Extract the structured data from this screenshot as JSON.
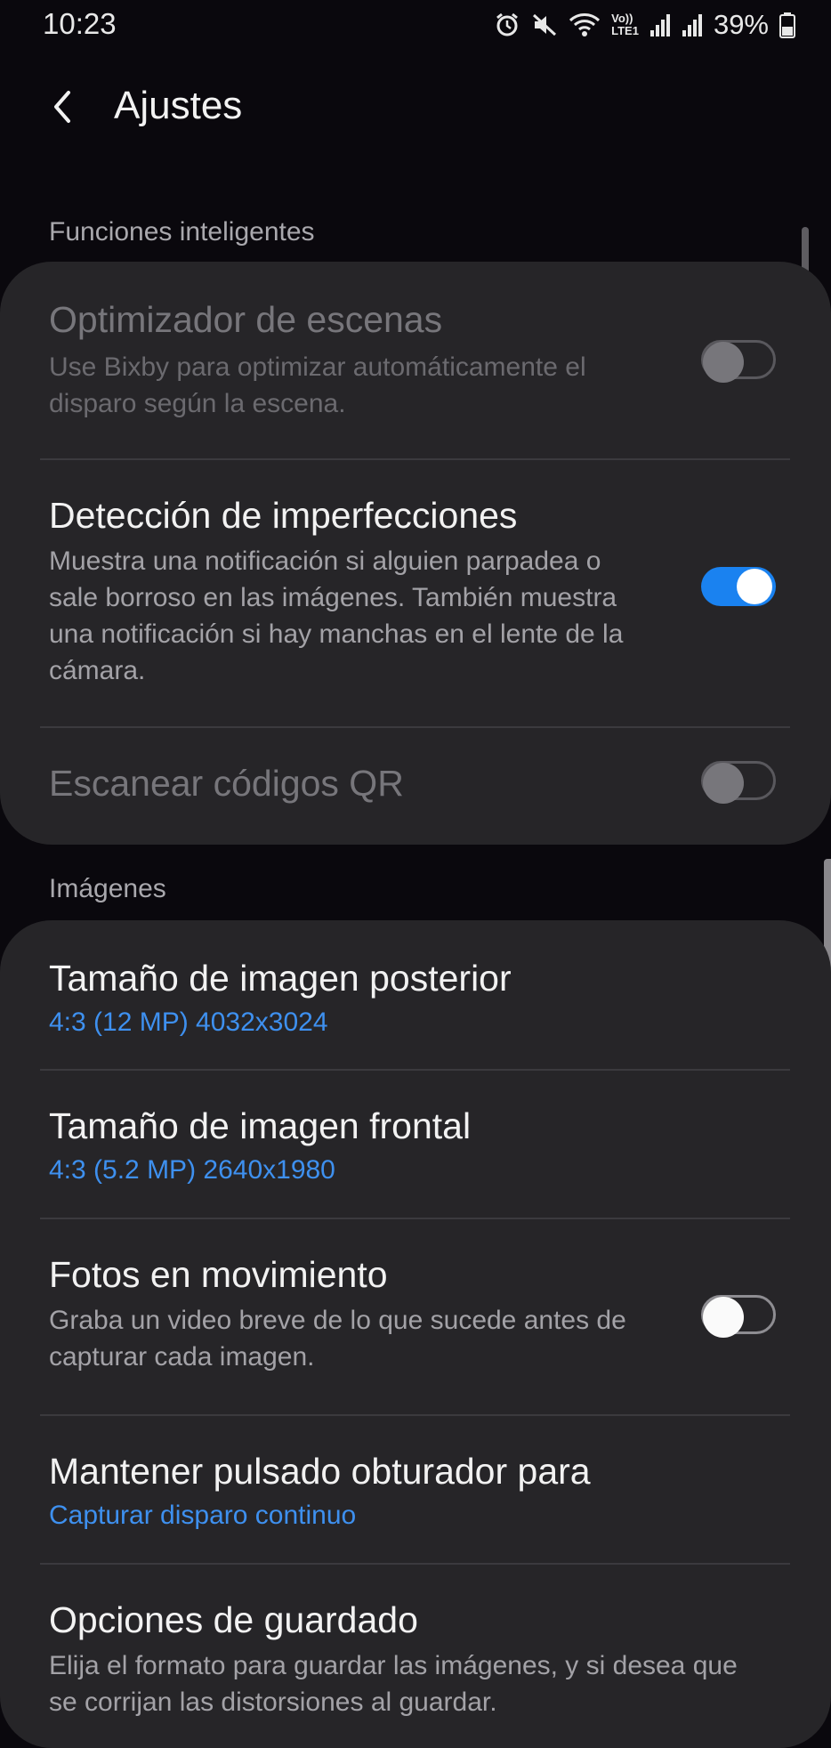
{
  "status_bar": {
    "time": "10:23",
    "battery": "39%",
    "icons": [
      "alarm-icon",
      "mute-icon",
      "wifi-icon",
      "volte-icon",
      "signal-icon",
      "signal-icon",
      "battery-icon"
    ],
    "volte_label_top": "Vo))",
    "volte_label_bottom": "LTE1"
  },
  "header": {
    "title": "Ajustes"
  },
  "sections": {
    "smart": {
      "header": "Funciones inteligentes",
      "items": [
        {
          "title": "Optimizador de escenas",
          "subtitle": "Use Bixby para optimizar automáticamente el disparo según la escena.",
          "toggle": "off",
          "enabled": false
        },
        {
          "title": "Detección de imperfecciones",
          "subtitle": "Muestra una notificación si alguien parpadea o sale borroso en las imágenes. También muestra una notificación si hay manchas en el lente de la cámara.",
          "toggle": "on",
          "enabled": true
        },
        {
          "title": "Escanear códigos QR",
          "toggle": "off",
          "enabled": false
        }
      ]
    },
    "images": {
      "header": "Imágenes",
      "items": [
        {
          "title": "Tamaño de imagen posterior",
          "value": "4:3 (12 MP) 4032x3024"
        },
        {
          "title": "Tamaño de imagen frontal",
          "value": "4:3 (5.2 MP) 2640x1980"
        },
        {
          "title": "Fotos en movimiento",
          "subtitle": "Graba un video breve de lo que sucede antes de capturar cada imagen.",
          "toggle": "off",
          "enabled": true
        },
        {
          "title": "Mantener pulsado obturador para",
          "value": "Capturar disparo continuo"
        },
        {
          "title": "Opciones de guardado",
          "subtitle": "Elija el formato para guardar las imágenes, y si desea que se corrijan las distorsiones al guardar."
        }
      ]
    }
  },
  "colors": {
    "background": "#0a080d",
    "card": "#262528",
    "accent": "#3e90ef",
    "toggle_on": "#1a82f0"
  }
}
